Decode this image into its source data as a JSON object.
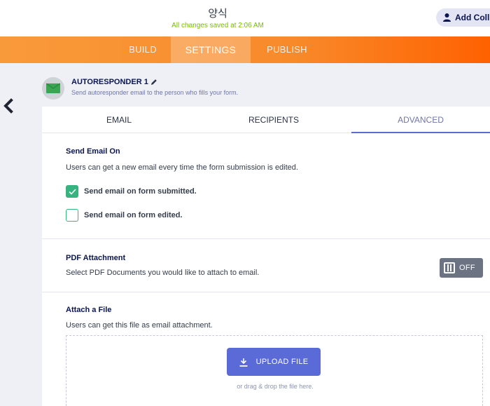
{
  "header": {
    "form_title": "양식",
    "save_status": "All changes saved at 2:06 AM",
    "collaborators_label": "Add Coll"
  },
  "nav": {
    "build": "BUILD",
    "settings": "SETTINGS",
    "publish": "PUBLISH"
  },
  "autoresponder": {
    "title": "AUTORESPONDER 1",
    "subtitle": "Send autoresponder email to the person who fills your form."
  },
  "tabs": {
    "email": "EMAIL",
    "recipients": "RECIPIENTS",
    "advanced": "ADVANCED"
  },
  "send_email_on": {
    "title": "Send Email On",
    "description": "Users can get a new email every time the form submission is edited.",
    "options": [
      {
        "label": "Send email on form submitted.",
        "checked": true
      },
      {
        "label": "Send email on form edited.",
        "checked": false
      }
    ]
  },
  "pdf_attachment": {
    "title": "PDF Attachment",
    "description": "Select PDF Documents you would like to attach to email.",
    "toggle_label": "OFF"
  },
  "attach_file": {
    "title": "Attach a File",
    "description": "Users can get this file as email attachment.",
    "upload_label": "UPLOAD FILE",
    "drop_hint": "or drag & drop the file here."
  },
  "colors": {
    "accent": "#5a6bd8",
    "orange": "#f88a2a",
    "check_green": "#36b37e",
    "save_green": "#78bb07"
  }
}
